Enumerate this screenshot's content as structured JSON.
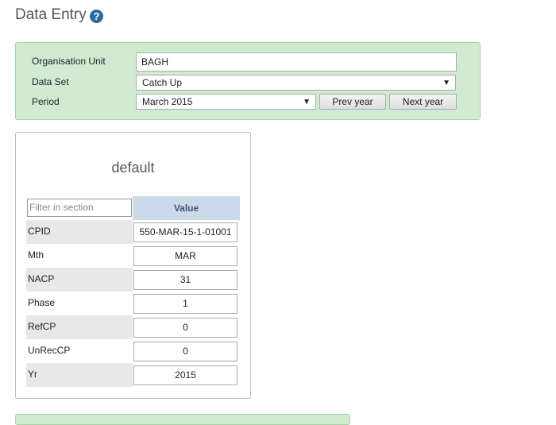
{
  "header": {
    "title": "Data Entry",
    "help_icon": "question-circle-icon"
  },
  "criteria": {
    "org_unit": {
      "label": "Organisation Unit",
      "value": "BAGH"
    },
    "data_set": {
      "label": "Data Set",
      "value": "Catch Up"
    },
    "period": {
      "label": "Period",
      "value": "March 2015",
      "prev_label": "Prev year",
      "next_label": "Next year"
    },
    "arrow": "▼"
  },
  "section": {
    "title": "default",
    "filter_placeholder": "Filter in section",
    "value_header": "Value",
    "rows": [
      {
        "label": "CPID",
        "value": "550-MAR-15-1-01001"
      },
      {
        "label": "Mth",
        "value": "MAR"
      },
      {
        "label": "NACP",
        "value": "31"
      },
      {
        "label": "Phase",
        "value": "1"
      },
      {
        "label": "RefCP",
        "value": "0"
      },
      {
        "label": "UnRecCP",
        "value": "0"
      },
      {
        "label": "Yr",
        "value": "2015"
      }
    ]
  },
  "colors": {
    "panel_bg": "#d1ebd3",
    "header_bg": "#c9dbe9",
    "help_icon": "#2c6aa0"
  }
}
